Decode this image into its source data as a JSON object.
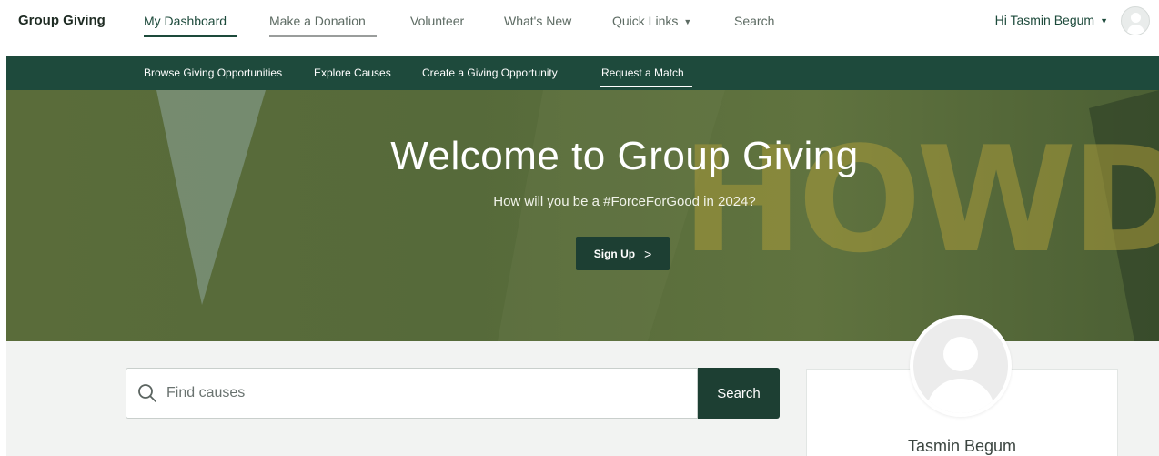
{
  "topnav": {
    "brand": "Group Giving",
    "items": [
      {
        "label": "My Dashboard"
      },
      {
        "label": "Make a Donation"
      },
      {
        "label": "Volunteer"
      },
      {
        "label": "What's New"
      },
      {
        "label": "Quick Links"
      },
      {
        "label": "Search"
      }
    ],
    "greeting": "Hi Tasmin Begum"
  },
  "subnav": {
    "items": [
      {
        "label": "Browse Giving Opportunities"
      },
      {
        "label": "Explore Causes"
      },
      {
        "label": "Create a Giving Opportunity"
      },
      {
        "label": "Request a Match"
      }
    ]
  },
  "hero": {
    "title": "Welcome to Group Giving",
    "subtitle": "How will you be a #ForceForGood in 2024?",
    "button_label": "Sign Up",
    "watermark": "HOWDEN"
  },
  "search": {
    "placeholder": "Find causes",
    "button_label": "Search"
  },
  "profile": {
    "name": "Tasmin Begum"
  },
  "colors": {
    "primary": "#1e4a3c",
    "button": "#1d3f33",
    "hero": "#5a6c3a"
  }
}
